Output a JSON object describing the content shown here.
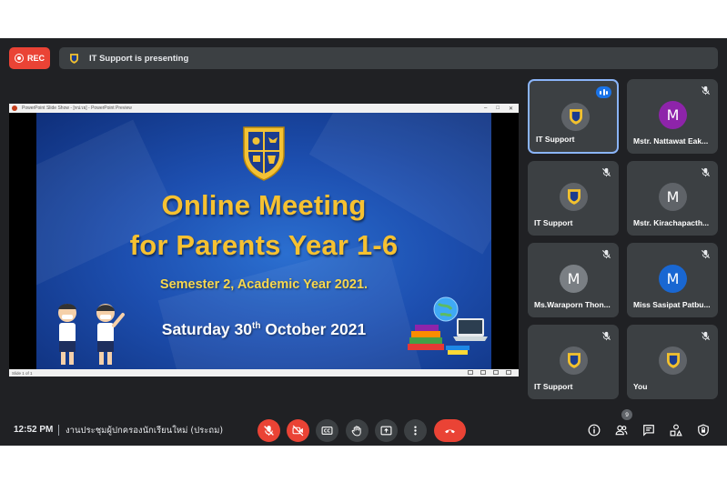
{
  "recording": {
    "label": "REC"
  },
  "presenting_banner": {
    "text": "IT Support is presenting"
  },
  "presentation": {
    "window_title": "PowerPoint Slide Show - [หน่วย] - PowerPoint Preview",
    "status_text": "Slide 1 of 1",
    "slide": {
      "title_line1": "Online Meeting",
      "title_line2": "for Parents Year 1-6",
      "subtitle": "Semester 2, Academic Year 2021.",
      "date_pre": "Saturday 30",
      "date_sup": "th",
      "date_post": " October 2021"
    }
  },
  "participants": [
    {
      "name": "IT Support",
      "avatar": "crest",
      "speaking": true,
      "muted": false
    },
    {
      "name": "Mstr. Nattawat Eak...",
      "avatar": "M",
      "avatar_color": "#8e24aa",
      "muted": true
    },
    {
      "name": "IT Support",
      "avatar": "crest",
      "muted": true
    },
    {
      "name": "Mstr. Kirachapacth...",
      "avatar": "M",
      "avatar_color": "#5f6368",
      "muted": true
    },
    {
      "name": "Ms.Waraporn Thon...",
      "avatar": "M",
      "avatar_color": "#7a7f84",
      "muted": true
    },
    {
      "name": "Miss Sasipat Patbu...",
      "avatar": "M",
      "avatar_color": "#1967d2",
      "muted": true
    },
    {
      "name": "IT Support",
      "avatar": "crest",
      "muted": true
    },
    {
      "name": "You",
      "avatar": "crest",
      "muted": true
    }
  ],
  "bottom_bar": {
    "time": "12:52 PM",
    "meeting_title": "งานประชุมผู้ปกครองนักเรียนใหม่ (ประถม)",
    "participant_count": "9"
  },
  "colors": {
    "background": "#202124",
    "tile": "#3c4043",
    "danger": "#ea4335",
    "accent": "#8ab4f8",
    "slide_title": "#f6c131"
  }
}
